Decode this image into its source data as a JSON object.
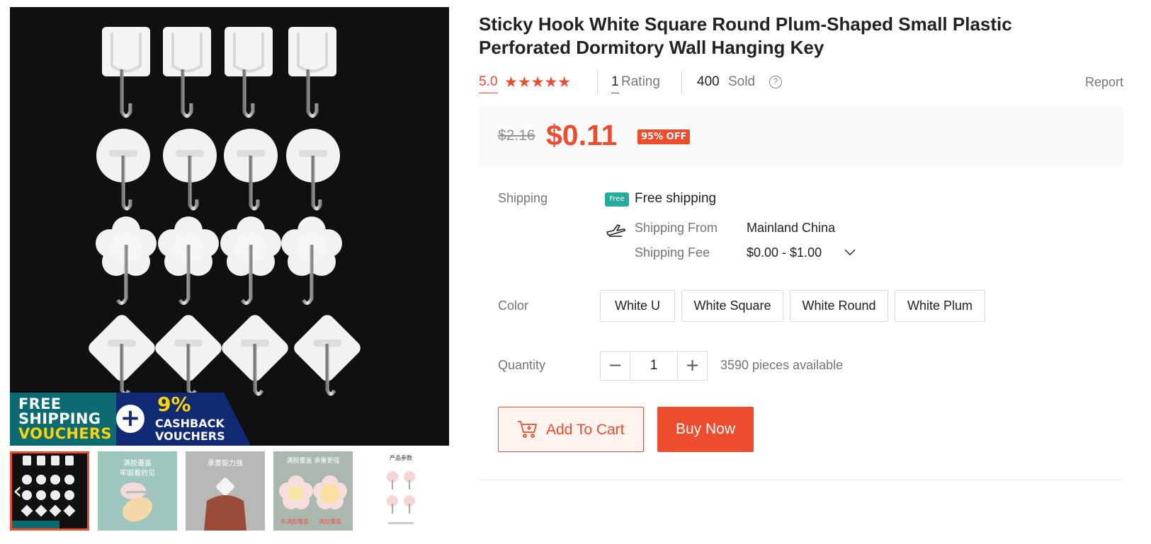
{
  "product": {
    "title": "Sticky Hook White Square Round Plum-Shaped Small Plastic Perforated Dormitory Wall Hanging Key",
    "rating": "5.0",
    "stars": "★★★★★",
    "rating_count": "1",
    "rating_label": "Rating",
    "sold_count": "400",
    "sold_label": "Sold",
    "report_label": "Report"
  },
  "price": {
    "original": "$2.16",
    "current": "$0.11",
    "discount_badge": "95% OFF"
  },
  "shipping": {
    "label": "Shipping",
    "free_badge": "Free",
    "free_text": "Free shipping",
    "from_label": "Shipping From",
    "from_value": "Mainland China",
    "fee_label": "Shipping Fee",
    "fee_value": "$0.00 - $1.00"
  },
  "color": {
    "label": "Color",
    "options": [
      "White U",
      "White Square",
      "White Round",
      "White Plum"
    ]
  },
  "quantity": {
    "label": "Quantity",
    "minus": "−",
    "plus": "+",
    "value": "1",
    "available": "3590 pieces available"
  },
  "actions": {
    "add_to_cart": "Add To Cart",
    "buy_now": "Buy Now"
  },
  "gallery": {
    "banner_free_1": "FREE",
    "banner_free_2": "SHIPPING",
    "banner_free_3": "VOUCHERS",
    "banner_plus": "+",
    "banner_pct": "9%",
    "banner_cash_1": "CASHBACK",
    "banner_cash_2": "VOUCHERS",
    "prev_arrow": "‹",
    "thumb_2_caption_1": "满胶覆盖",
    "thumb_2_caption_2": "牢固看的见",
    "thumb_3_caption": "承重能力强",
    "thumb_4_caption": "满胶覆盖 承重更强",
    "thumb_4_tag_1": "非满胶覆盖",
    "thumb_4_tag_2": "满胶覆盖",
    "thumb_5_caption": "产品参数"
  },
  "colors": {
    "accent": "#ee4d2d",
    "free_green": "#26aa99",
    "price_bg": "#fafafa"
  }
}
